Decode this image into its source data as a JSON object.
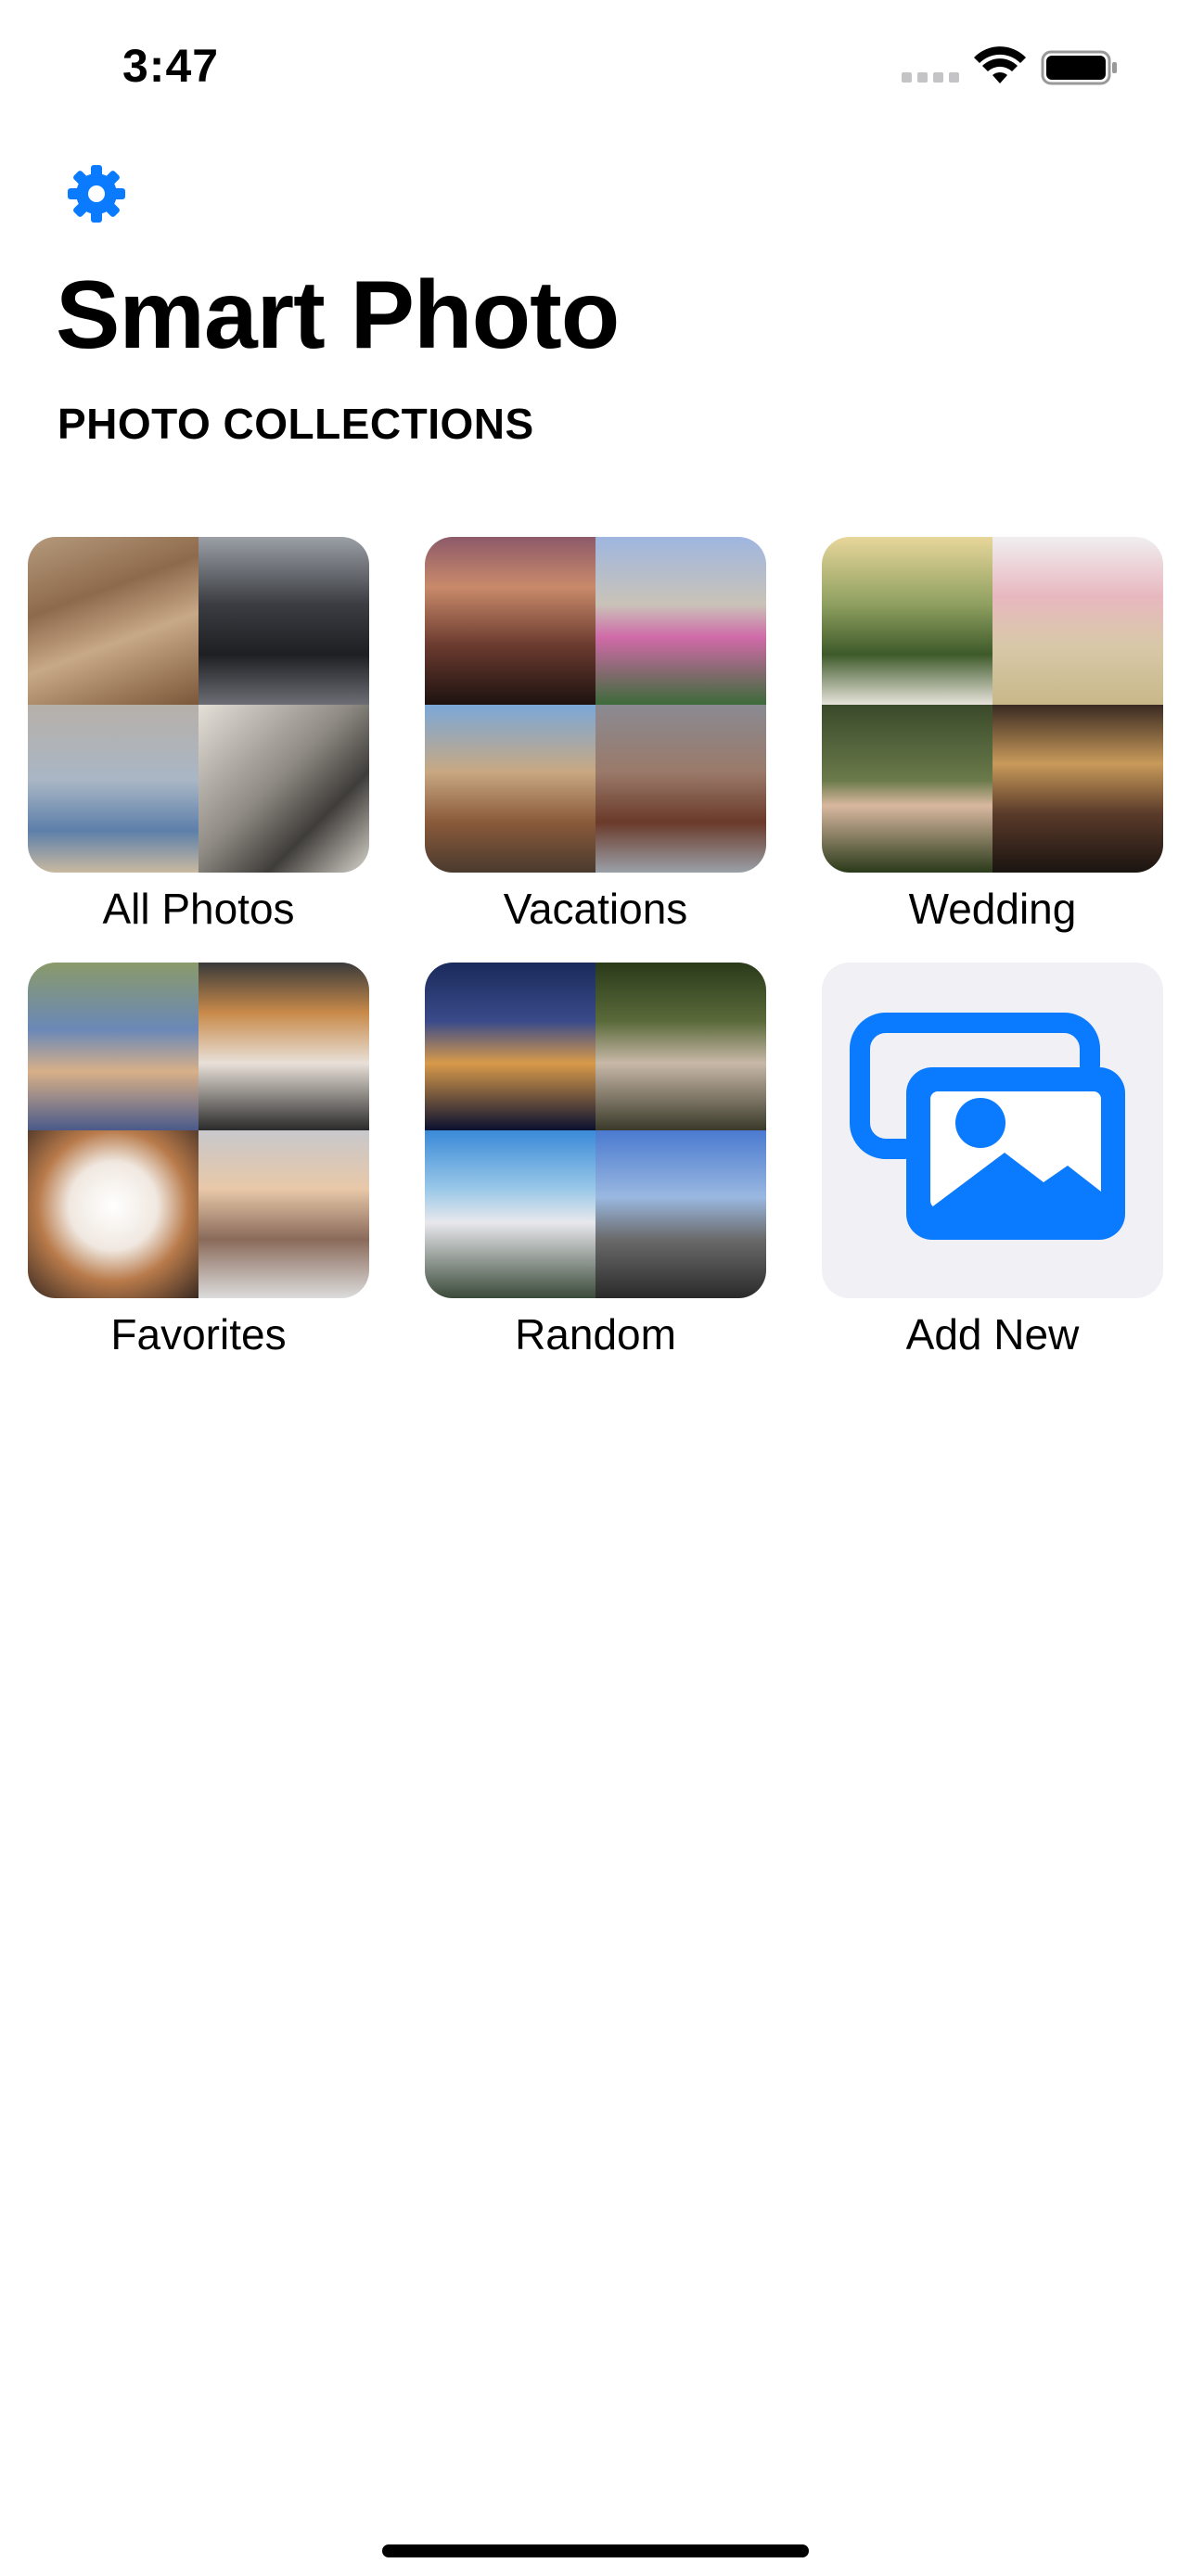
{
  "status_bar": {
    "time": "3:47"
  },
  "header": {
    "settings_icon": "gear-icon",
    "title": "Smart Photo",
    "section_title": "PHOTO COLLECTIONS"
  },
  "collections": [
    {
      "label": "All Photos"
    },
    {
      "label": "Vacations"
    },
    {
      "label": "Wedding"
    },
    {
      "label": "Favorites"
    },
    {
      "label": "Random"
    },
    {
      "label": "Add New",
      "icon": "photo-stack-icon"
    }
  ],
  "colors": {
    "accent": "#0a7aff",
    "add_tile_background": "#f0f0f5",
    "text": "#000000",
    "background": "#ffffff"
  }
}
